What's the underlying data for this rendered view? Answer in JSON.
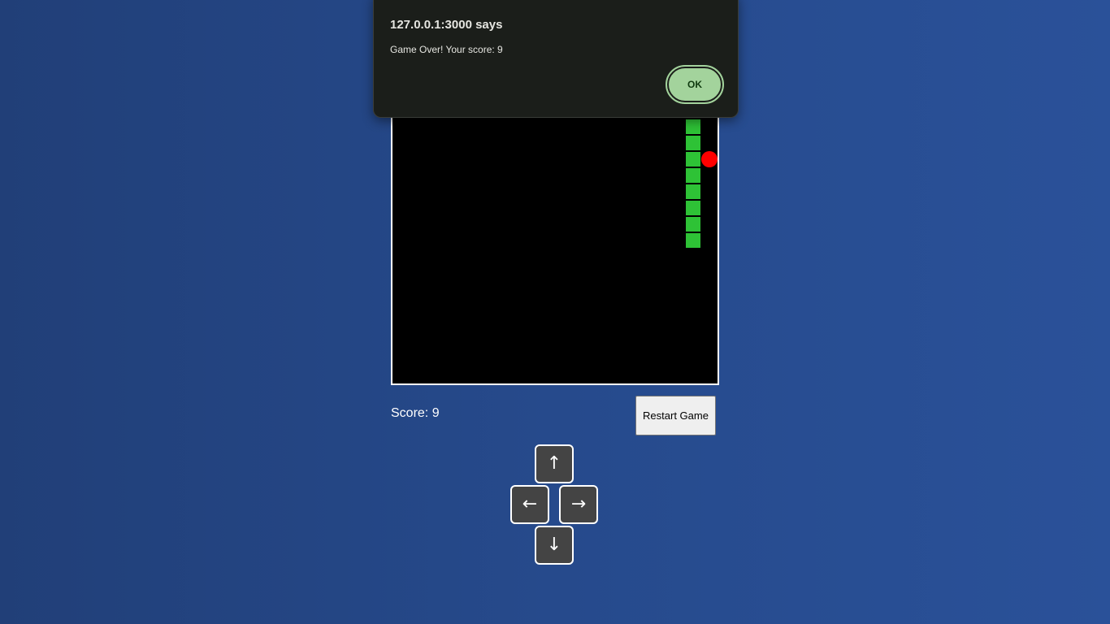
{
  "dialog": {
    "title": "127.0.0.1:3000 says",
    "message": "Game Over! Your score: 9",
    "ok_label": "OK"
  },
  "game": {
    "score_text": "Score: 9",
    "restart_label": "Restart Game",
    "snake_color": "#2ec236",
    "food_color": "#ff0000",
    "snake_cells": [
      [
        18,
        2
      ],
      [
        19,
        2
      ],
      [
        18,
        3
      ],
      [
        18,
        4
      ],
      [
        18,
        5
      ],
      [
        18,
        6
      ],
      [
        18,
        7
      ],
      [
        18,
        8
      ],
      [
        18,
        9
      ],
      [
        18,
        10
      ]
    ],
    "food_cell": [
      19,
      5
    ]
  },
  "controls": {
    "up": "↑",
    "left": "←",
    "right": "→",
    "down": "↓"
  }
}
